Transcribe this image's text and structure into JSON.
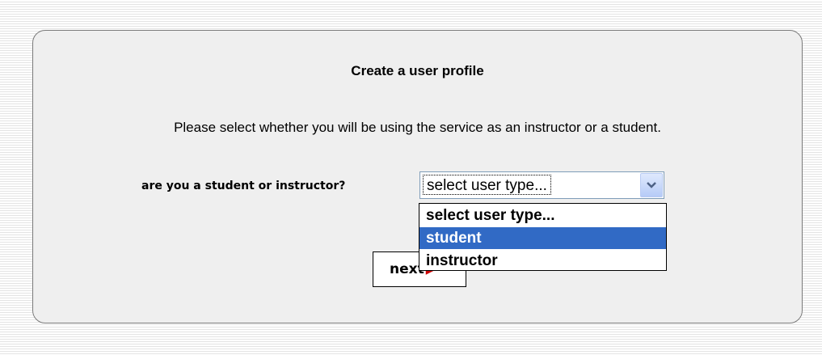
{
  "page": {
    "title": "Create a user profile",
    "instructions": "Please select whether you will be using the service as an instructor or a student."
  },
  "form": {
    "field_label": "are you a student or instructor?",
    "select_value": "select user type...",
    "options": [
      "select user type...",
      "student",
      "instructor"
    ],
    "highlighted_option": "student",
    "next_label": "next",
    "next_icon": "arrow-right-icon"
  },
  "colors": {
    "highlight": "#316ac5",
    "panel_background": "#efefef",
    "next_arrow": "#cc0000"
  }
}
